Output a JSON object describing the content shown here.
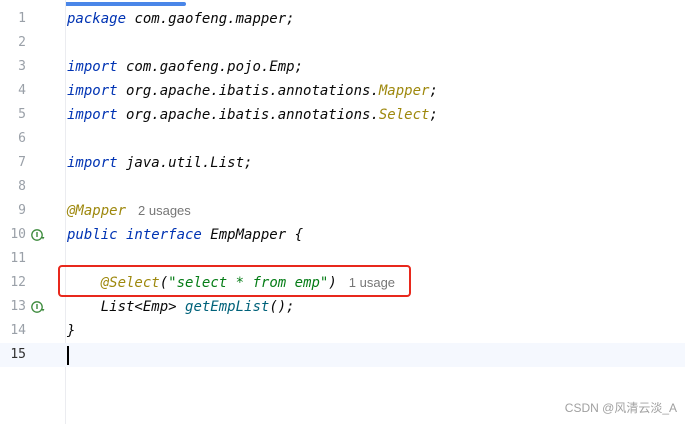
{
  "editor": {
    "lines": [
      {
        "num": "1",
        "parts": [
          [
            "kw",
            "package"
          ],
          [
            "plain",
            " com.gaofeng.mapper;"
          ]
        ]
      },
      {
        "num": "2",
        "parts": []
      },
      {
        "num": "3",
        "parts": [
          [
            "kw",
            "import"
          ],
          [
            "plain",
            " com.gaofeng.pojo.Emp;"
          ]
        ]
      },
      {
        "num": "4",
        "parts": [
          [
            "kw",
            "import"
          ],
          [
            "plain",
            " org.apache.ibatis.annotations."
          ],
          [
            "ann",
            "Mapper"
          ],
          [
            "plain",
            ";"
          ]
        ]
      },
      {
        "num": "5",
        "parts": [
          [
            "kw",
            "import"
          ],
          [
            "plain",
            " org.apache.ibatis.annotations."
          ],
          [
            "ann",
            "Select"
          ],
          [
            "plain",
            ";"
          ]
        ]
      },
      {
        "num": "6",
        "parts": []
      },
      {
        "num": "7",
        "parts": [
          [
            "kw",
            "import"
          ],
          [
            "plain",
            " java.util.List;"
          ]
        ]
      },
      {
        "num": "8",
        "parts": []
      },
      {
        "num": "9",
        "parts": [
          [
            "ann",
            "@Mapper"
          ],
          [
            "hint",
            "2 usages"
          ]
        ]
      },
      {
        "num": "10",
        "icon": "implementation-icon",
        "parts": [
          [
            "kw",
            "public interface"
          ],
          [
            "plain",
            " EmpMapper {"
          ]
        ]
      },
      {
        "num": "11",
        "parts": []
      },
      {
        "num": "12",
        "parts": [
          [
            "plain",
            "    "
          ],
          [
            "ann",
            "@Select"
          ],
          [
            "plain",
            "("
          ],
          [
            "str",
            "\"select * from emp\""
          ],
          [
            "plain",
            ")"
          ],
          [
            "hint",
            "1 usage"
          ]
        ]
      },
      {
        "num": "13",
        "icon": "implementation-icon",
        "parts": [
          [
            "plain",
            "    List<Emp> "
          ],
          [
            "mth",
            "getEmpList"
          ],
          [
            "plain",
            "();"
          ]
        ]
      },
      {
        "num": "14",
        "parts": [
          [
            "plain",
            "}"
          ]
        ]
      },
      {
        "num": "15",
        "parts": [],
        "current": true
      }
    ]
  },
  "watermark": "CSDN @风清云淡_A",
  "colors": {
    "keyword": "#0033b3",
    "annotation": "#9e880d",
    "string": "#067d17",
    "method": "#00627a",
    "highlight_box": "#e8281c",
    "gutter_icon": "#3c8a3c"
  }
}
